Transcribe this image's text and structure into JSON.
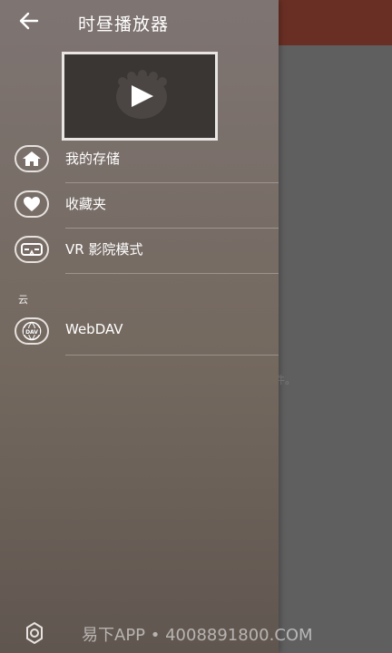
{
  "drawer": {
    "title": "时昼播放器",
    "back_icon": "arrow-left-icon",
    "thumbnail_icon": "play-icon",
    "menu": [
      {
        "label": "我的存储",
        "icon": "home-icon"
      },
      {
        "label": "收藏夹",
        "icon": "heart-icon"
      },
      {
        "label": "VR 影院模式",
        "icon": "vr-headset-icon"
      }
    ],
    "section_cloud": "云",
    "cloud_items": [
      {
        "label": "WebDAV",
        "icon": "webdav-globe-icon",
        "icon_text": "DAV"
      }
    ],
    "settings_icon": "gear-icon"
  },
  "background": {
    "header_color": "#6a2f24",
    "partial_text": "件。"
  },
  "watermark": "易下APP • 4008891800.COM",
  "colors": {
    "drawer_top": "#7e7472",
    "drawer_bottom": "#605650",
    "icon_border": "#e6e1de"
  }
}
